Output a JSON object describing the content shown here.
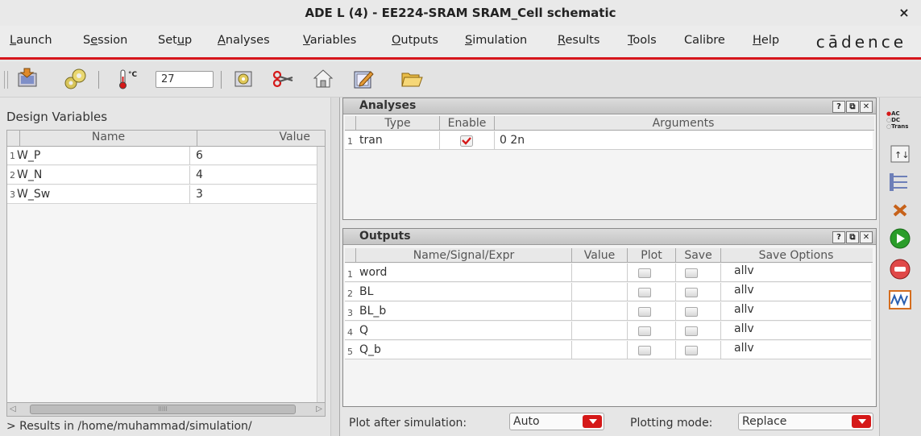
{
  "window": {
    "title": "ADE L (4) - EE224-SRAM SRAM_Cell schematic",
    "close_glyph": "×"
  },
  "menubar": {
    "items": [
      {
        "label": "Launch"
      },
      {
        "label": "Session"
      },
      {
        "label": "Setup"
      },
      {
        "label": "Analyses"
      },
      {
        "label": "Variables"
      },
      {
        "label": "Outputs"
      },
      {
        "label": "Simulation"
      },
      {
        "label": "Results"
      },
      {
        "label": "Tools"
      },
      {
        "label": "Calibre"
      },
      {
        "label": "Help"
      }
    ],
    "logo": "cādence"
  },
  "toolbar": {
    "temperature": "27",
    "icons": [
      "load-state-icon",
      "settings-gears-icon",
      "thermometer-icon",
      "setup-gear-icon",
      "scissors-icon",
      "home-icon",
      "edit-form-icon",
      "open-folder-icon"
    ]
  },
  "design_variables": {
    "title": "Design Variables",
    "columns": [
      "Name",
      "Value"
    ],
    "rows": [
      {
        "num": "1",
        "name": "W_P",
        "value": "6"
      },
      {
        "num": "2",
        "name": "W_N",
        "value": "4"
      },
      {
        "num": "3",
        "name": "W_Sw",
        "value": "3"
      }
    ],
    "scroll_thumb_glyph": "IIIII"
  },
  "status": {
    "text": "> Results in /home/muhammad/simulation/"
  },
  "analyses": {
    "title": "Analyses",
    "columns": [
      "Type",
      "Enable",
      "Arguments"
    ],
    "rows": [
      {
        "num": "1",
        "type": "tran",
        "enabled": true,
        "arguments": "0 2n"
      }
    ],
    "buttons": [
      "?",
      "⧉",
      "✕"
    ]
  },
  "outputs": {
    "title": "Outputs",
    "columns": [
      "Name/Signal/Expr",
      "Value",
      "Plot",
      "Save",
      "Save Options"
    ],
    "rows": [
      {
        "num": "1",
        "name": "word",
        "value": "",
        "plot": false,
        "save": false,
        "options": "allv"
      },
      {
        "num": "2",
        "name": "BL",
        "value": "",
        "plot": false,
        "save": false,
        "options": "allv"
      },
      {
        "num": "3",
        "name": "BL_b",
        "value": "",
        "plot": false,
        "save": false,
        "options": "allv"
      },
      {
        "num": "4",
        "name": "Q",
        "value": "",
        "plot": false,
        "save": false,
        "options": "allv"
      },
      {
        "num": "5",
        "name": "Q_b",
        "value": "",
        "plot": false,
        "save": false,
        "options": "allv"
      }
    ],
    "buttons": [
      "?",
      "⧉",
      "✕"
    ]
  },
  "bottom": {
    "plot_after_label": "Plot after simulation:",
    "plot_after_value": "Auto",
    "plotting_mode_label": "Plotting mode:",
    "plotting_mode_value": "Replace"
  },
  "right_toolbar": {
    "analysis_labels": [
      "AC",
      "DC",
      "Trans"
    ],
    "icons": [
      "choose-analyses-icon",
      "edit-variables-icon",
      "setup-outputs-icon",
      "delete-icon",
      "run-simulation-icon",
      "stop-simulation-icon",
      "plot-outputs-icon"
    ]
  },
  "colors": {
    "accent_red": "#d51818",
    "run_green": "#2a9d2a",
    "panel_bg": "#f4f4f4"
  }
}
